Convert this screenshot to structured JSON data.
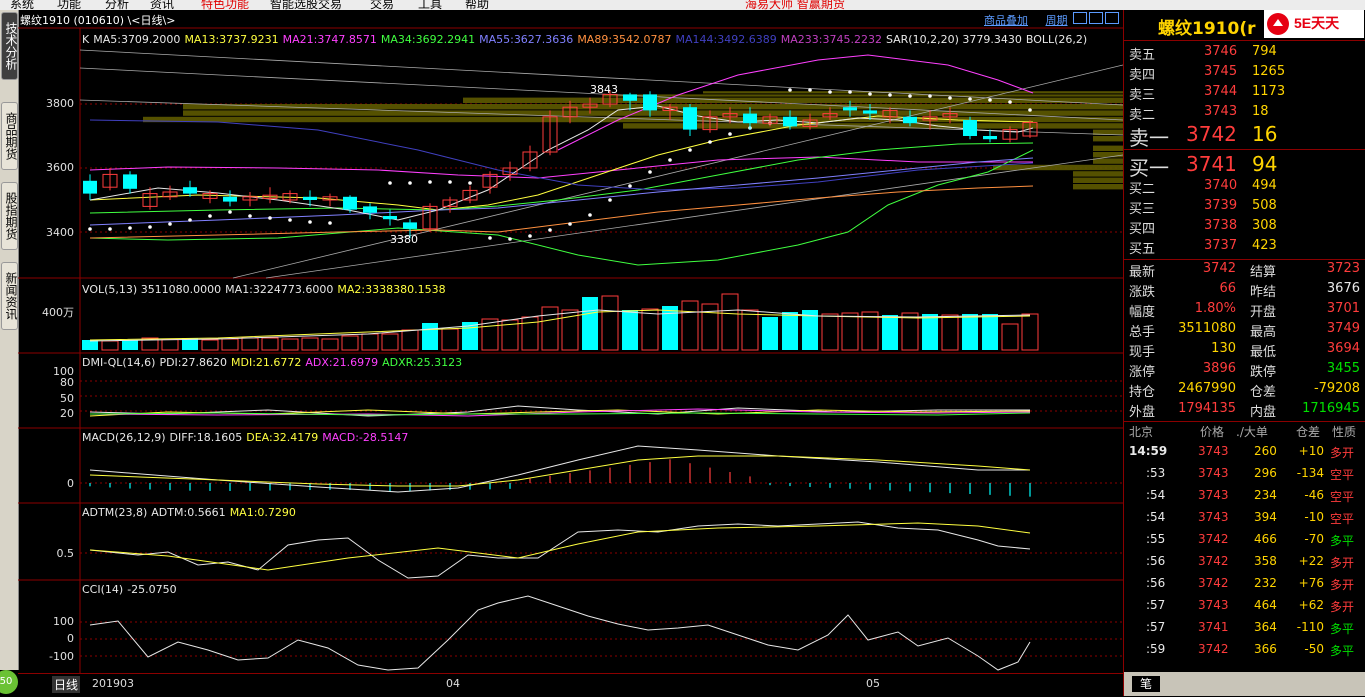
{
  "menu": {
    "items": [
      "系统",
      "功能",
      "分析",
      "资讯",
      "特色功能",
      "智能选股交易",
      "交易",
      "工具",
      "帮助"
    ],
    "promo": "海易大师  智赢期货"
  },
  "left_tabs": [
    "技术分析",
    "商品期货",
    "股指期货",
    "新闻资讯"
  ],
  "left_badge": "50",
  "chart": {
    "title": "螺纹1910 (010610) \\<日线\\>",
    "toolbar": [
      "商品叠加",
      "周期"
    ],
    "main_legend": [
      {
        "text": "K",
        "color": "#e8e8e8"
      },
      {
        "text": "MA5:3709.2000",
        "color": "#e8e8e8"
      },
      {
        "text": "MA13:3737.9231",
        "color": "#ffff40"
      },
      {
        "text": "MA21:3747.8571",
        "color": "#ff40ff"
      },
      {
        "text": "MA34:3692.2941",
        "color": "#40ff40"
      },
      {
        "text": "MA55:3627.3636",
        "color": "#8080ff"
      },
      {
        "text": "MA89:3542.0787",
        "color": "#ff9040"
      },
      {
        "text": "MA144:3492.6389",
        "color": "#4040c0"
      },
      {
        "text": "MA233:3745.2232",
        "color": "#c040c0"
      },
      {
        "text": "SAR(10,2,20)  3779.3430",
        "color": "#e8e8e8"
      },
      {
        "text": "BOLL(26,2)",
        "color": "#e8e8e8"
      }
    ],
    "main_yticks": [
      "3800",
      "3600",
      "3400"
    ],
    "annotations": {
      "high": "3843",
      "low": "3380"
    },
    "vol_legend": [
      {
        "text": "VOL(5,13) 3511080.0000",
        "color": "#e8e8e8"
      },
      {
        "text": "MA1:3224773.6000",
        "color": "#e8e8e8"
      },
      {
        "text": "MA2:3338380.1538",
        "color": "#ffff40"
      }
    ],
    "vol_ytick": "400万",
    "dmi_legend": [
      {
        "text": "DMI-QL(14,6)",
        "color": "#e8e8e8"
      },
      {
        "text": "PDI:27.8620",
        "color": "#e8e8e8"
      },
      {
        "text": "MDI:21.6772",
        "color": "#ffff40"
      },
      {
        "text": "ADX:21.6979",
        "color": "#ff40ff"
      },
      {
        "text": "ADXR:25.3123",
        "color": "#40ff40"
      }
    ],
    "dmi_yticks": [
      "100",
      "80",
      "50",
      "20"
    ],
    "macd_legend": [
      {
        "text": "MACD(26,12,9)",
        "color": "#e8e8e8"
      },
      {
        "text": "DIFF:18.1605",
        "color": "#e8e8e8"
      },
      {
        "text": "DEA:32.4179",
        "color": "#ffff40"
      },
      {
        "text": "MACD:-28.5147",
        "color": "#ff40ff"
      }
    ],
    "macd_ytick": "0",
    "adtm_legend": [
      {
        "text": "ADTM(23,8)",
        "color": "#e8e8e8"
      },
      {
        "text": "ADTM:0.5661",
        "color": "#e8e8e8"
      },
      {
        "text": "MA1:0.7290",
        "color": "#ffff40"
      }
    ],
    "adtm_ytick": "0.5",
    "cci_legend": [
      {
        "text": "CCI(14)",
        "color": "#e8e8e8"
      },
      {
        "text": "-25.0750",
        "color": "#e8e8e8"
      }
    ],
    "cci_yticks": [
      "100",
      "0",
      "-100"
    ],
    "bottom": {
      "period": "日线",
      "dates": [
        "201903",
        "04",
        "05"
      ]
    }
  },
  "chart_data": {
    "type": "candlestick",
    "title": "螺纹1910 (010610) \\<日线\\>",
    "x_labels": [
      "201903",
      "04",
      "05"
    ],
    "ylim": [
      3300,
      3950
    ],
    "high": 3843,
    "low": 3380,
    "volume_label": "400万",
    "indicators": {
      "DMI_ylim": [
        0,
        100
      ],
      "CCI_ticks": [
        100,
        0,
        -100
      ]
    }
  },
  "quote": {
    "title": "螺纹1910(r",
    "logo": "5E天天",
    "sells": [
      {
        "label": "卖五",
        "price": "3746",
        "vol": "794"
      },
      {
        "label": "卖四",
        "price": "3745",
        "vol": "1265"
      },
      {
        "label": "卖三",
        "price": "3744",
        "vol": "1173"
      },
      {
        "label": "卖二",
        "price": "3743",
        "vol": "18"
      },
      {
        "label": "卖一",
        "price": "3742",
        "vol": "16"
      }
    ],
    "buys": [
      {
        "label": "买一",
        "price": "3741",
        "vol": "94"
      },
      {
        "label": "买二",
        "price": "3740",
        "vol": "494"
      },
      {
        "label": "买三",
        "price": "3739",
        "vol": "508"
      },
      {
        "label": "买四",
        "price": "3738",
        "vol": "308"
      },
      {
        "label": "买五",
        "price": "3737",
        "vol": "423"
      }
    ],
    "stats": [
      {
        "l1": "最新",
        "v1": "3742",
        "c1": "red",
        "l2": "结算",
        "v2": "3723",
        "c2": "red"
      },
      {
        "l1": "涨跌",
        "v1": "66",
        "c1": "red",
        "l2": "昨结",
        "v2": "3676",
        "c2": "wht"
      },
      {
        "l1": "幅度",
        "v1": "1.80%",
        "c1": "red",
        "l2": "开盘",
        "v2": "3701",
        "c2": "red"
      },
      {
        "l1": "总手",
        "v1": "3511080",
        "c1": "yel",
        "l2": "最高",
        "v2": "3749",
        "c2": "red"
      },
      {
        "l1": "现手",
        "v1": "130",
        "c1": "yel",
        "l2": "最低",
        "v2": "3694",
        "c2": "red"
      },
      {
        "l1": "涨停",
        "v1": "3896",
        "c1": "red",
        "l2": "跌停",
        "v2": "3455",
        "c2": "grn"
      },
      {
        "l1": "持仓",
        "v1": "2467990",
        "c1": "yel",
        "l2": "仓差",
        "v2": "-79208",
        "c2": "yel"
      },
      {
        "l1": "外盘",
        "v1": "1794135",
        "c1": "red",
        "l2": "内盘",
        "v2": "1716945",
        "c2": "grn"
      }
    ],
    "ticks_header": [
      "北京",
      "价格",
      "./大单",
      "仓差",
      "性质"
    ],
    "ticks": [
      {
        "time": "14:59",
        "price": "3743",
        "vol": "260",
        "diff": "+10",
        "nature": "多开",
        "dc": "yel",
        "nc": "red"
      },
      {
        "time": ":53",
        "price": "3743",
        "vol": "296",
        "diff": "-134",
        "nature": "空平",
        "dc": "yel",
        "nc": "red"
      },
      {
        "time": ":54",
        "price": "3743",
        "vol": "234",
        "diff": "-46",
        "nature": "空平",
        "dc": "yel",
        "nc": "red"
      },
      {
        "time": ":54",
        "price": "3743",
        "vol": "394",
        "diff": "-10",
        "nature": "空平",
        "dc": "yel",
        "nc": "red"
      },
      {
        "time": ":55",
        "price": "3742",
        "vol": "466",
        "diff": "-70",
        "nature": "多平",
        "dc": "yel",
        "nc": "grn"
      },
      {
        "time": ":56",
        "price": "3742",
        "vol": "358",
        "diff": "+22",
        "nature": "多开",
        "dc": "yel",
        "nc": "red"
      },
      {
        "time": ":56",
        "price": "3742",
        "vol": "232",
        "diff": "+76",
        "nature": "多开",
        "dc": "yel",
        "nc": "red"
      },
      {
        "time": ":57",
        "price": "3743",
        "vol": "464",
        "diff": "+62",
        "nature": "多开",
        "dc": "yel",
        "nc": "red"
      },
      {
        "time": ":57",
        "price": "3741",
        "vol": "364",
        "diff": "-110",
        "nature": "多平",
        "dc": "yel",
        "nc": "grn"
      },
      {
        "time": ":59",
        "price": "3742",
        "vol": "366",
        "diff": "-50",
        "nature": "多平",
        "dc": "yel",
        "nc": "grn"
      }
    ],
    "bottom_tab": "笔"
  },
  "colors": {
    "up": "#ff3c3c",
    "down": "#00ffff",
    "panel_border": "#8b0000",
    "accent_yellow": "#ffd400",
    "link_blue": "#5c9bff"
  }
}
